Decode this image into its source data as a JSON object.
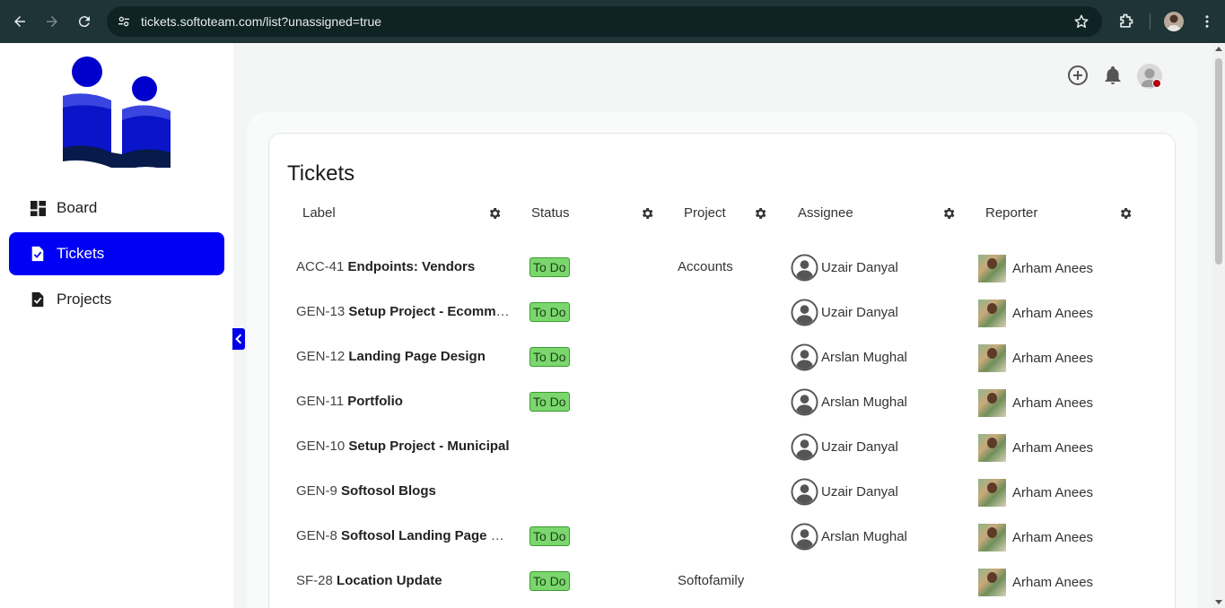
{
  "browser": {
    "url": "tickets.softoteam.com/list?unassigned=true"
  },
  "sidebar": {
    "items": [
      {
        "label": "Board",
        "icon": "dashboard-icon",
        "active": false
      },
      {
        "label": "Tickets",
        "icon": "ticket-doc-icon",
        "active": true
      },
      {
        "label": "Projects",
        "icon": "project-doc-icon",
        "active": false
      }
    ]
  },
  "header": {
    "icons": [
      "add-circle-icon",
      "bell-icon",
      "user-avatar-icon"
    ]
  },
  "main": {
    "title": "Tickets",
    "columns": [
      "Label",
      "Status",
      "Project",
      "Assignee",
      "Reporter"
    ],
    "rows": [
      {
        "key": "ACC-41",
        "name": "Endpoints: Vendors",
        "status": "To Do",
        "project": "Accounts",
        "assignee": "Uzair Danyal",
        "reporter": "Arham Anees"
      },
      {
        "key": "GEN-13",
        "name": "Setup Project - Ecommer...",
        "status": "To Do",
        "project": "",
        "assignee": "Uzair Danyal",
        "reporter": "Arham Anees"
      },
      {
        "key": "GEN-12",
        "name": "Landing Page Design",
        "status": "To Do",
        "project": "",
        "assignee": "Arslan Mughal",
        "reporter": "Arham Anees"
      },
      {
        "key": "GEN-11",
        "name": "Portfolio",
        "status": "To Do",
        "project": "",
        "assignee": "Arslan Mughal",
        "reporter": "Arham Anees"
      },
      {
        "key": "GEN-10",
        "name": "Setup Project - Municipal",
        "status": "",
        "project": "",
        "assignee": "Uzair Danyal",
        "reporter": "Arham Anees"
      },
      {
        "key": "GEN-9",
        "name": "Softosol Blogs",
        "status": "",
        "project": "",
        "assignee": "Uzair Danyal",
        "reporter": "Arham Anees"
      },
      {
        "key": "GEN-8",
        "name": "Softosol Landing Page De...",
        "status": "To Do",
        "project": "",
        "assignee": "Arslan Mughal",
        "reporter": "Arham Anees"
      },
      {
        "key": "SF-28",
        "name": "Location Update",
        "status": "To Do",
        "project": "Softofamily",
        "assignee": "",
        "reporter": "Arham Anees"
      }
    ]
  },
  "colors": {
    "accent": "#0000f5",
    "status_todo_bg": "#7bd66e",
    "chrome_bg": "#1f3437"
  }
}
